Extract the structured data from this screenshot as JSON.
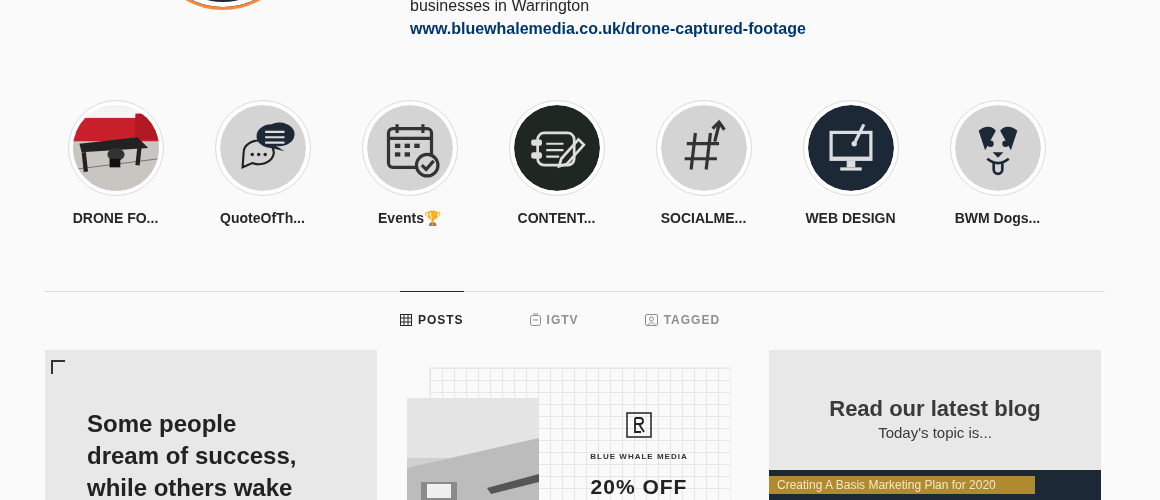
{
  "profile": {
    "bio_line": "businesses in Warrington",
    "link": "www.bluewhalemedia.co.uk/drone-captured-footage"
  },
  "highlights": [
    {
      "label": "DRONE FO...",
      "kind": "picture"
    },
    {
      "label": "QuoteOfTh...",
      "kind": "icon",
      "color": "#d4d4d4"
    },
    {
      "label": "Events🏆",
      "kind": "icon",
      "color": "#d4d4d4"
    },
    {
      "label": "CONTENT...",
      "kind": "icon",
      "color": "#1e2820"
    },
    {
      "label": "SOCIALME...",
      "kind": "icon",
      "color": "#d4d4d4"
    },
    {
      "label": "WEB DESIGN",
      "kind": "icon",
      "color": "#1c2836"
    },
    {
      "label": "BWM Dogs...",
      "kind": "icon",
      "color": "#d4d4d4"
    }
  ],
  "tabs": [
    {
      "label": "POSTS",
      "selected": true
    },
    {
      "label": "IGTV",
      "selected": false
    },
    {
      "label": "TAGGED",
      "selected": false
    }
  ],
  "posts": [
    {
      "kind": "quote",
      "lines": [
        "Some people",
        "dream of success,",
        "while others wake"
      ]
    },
    {
      "kind": "promo",
      "brand": "BLUE WHALE MEDIA",
      "headline": "20% OFF"
    },
    {
      "kind": "blog",
      "title": "Read our latest blog",
      "subtitle": "Today's topic is...",
      "banner": "Creating A Basis Marketing Plan for 2020"
    }
  ]
}
